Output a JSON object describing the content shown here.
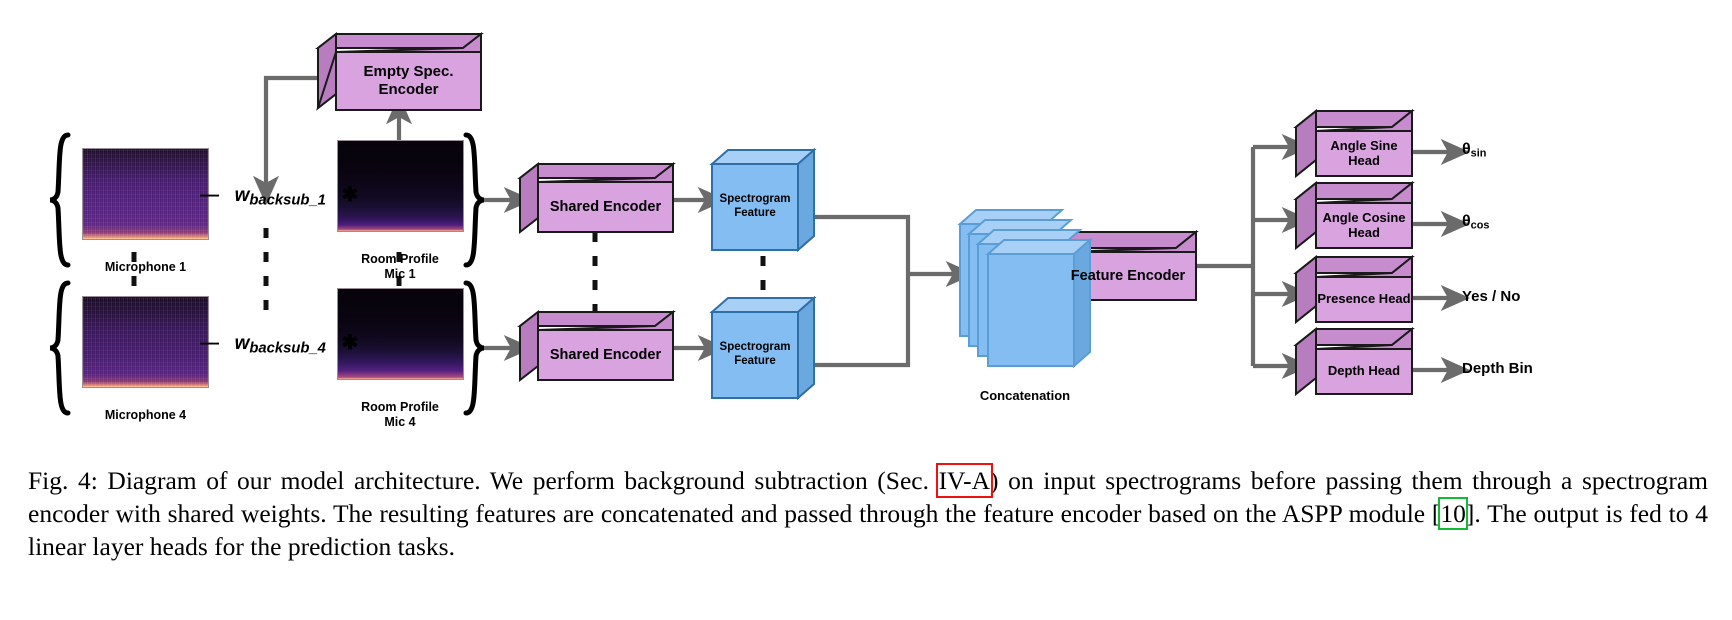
{
  "figure": {
    "title": "Diagram of our model architecture",
    "empty_spec_encoder": "Empty Spec.\nEncoder",
    "shared_encoder_1": "Shared Encoder",
    "shared_encoder_4": "Shared Encoder",
    "spectrogram_feature_1": "Spectrogram\nFeature",
    "spectrogram_feature_4": "Spectrogram\nFeature",
    "concatenation": "Concatenation",
    "feature_encoder": "Feature Encoder",
    "mic1_label": "Microphone 1",
    "mic4_label": "Microphone 4",
    "room_profile_1": "Room Profile\nMic 1",
    "room_profile_4": "Room Profile\nMic 4",
    "minus_sign": "—",
    "asterisk": "✱",
    "weight_1": {
      "base": "w",
      "sub": "backsub_1"
    },
    "weight_4": {
      "base": "w",
      "sub": "backsub_4"
    },
    "heads": [
      {
        "label": "Angle Sine\nHead",
        "output_base": "θ",
        "output_sub": "sin",
        "output_plain": ""
      },
      {
        "label": "Angle Cosine\nHead",
        "output_base": "θ",
        "output_sub": "cos",
        "output_plain": ""
      },
      {
        "label": "Presence Head",
        "output_base": "",
        "output_sub": "",
        "output_plain": "Yes / No"
      },
      {
        "label": "Depth Head",
        "output_base": "",
        "output_sub": "",
        "output_plain": "Depth Bin"
      }
    ],
    "colors": {
      "purple_front": "#d9a3e0",
      "purple_side": "#b77dbf",
      "purple_top": "#c68ccd",
      "blue_front": "#84bdf2",
      "blue_edge": "#2e6fa8",
      "arrow": "#6b6b6b",
      "outline": "#1a1a1a",
      "highlight_red": "#ee1111",
      "highlight_green": "#11bb33"
    }
  },
  "caption": {
    "figure_number": "Fig. 4:",
    "part1": " Diagram of our model architecture. We perform background subtraction (Sec. ",
    "ref_section": "IV-A",
    "part2": ") on input spectrograms before passing them through a spectrogram encoder with shared weights. The resulting features are concatenated and passed through the feature encoder based on the ASPP module [",
    "ref_citation": "10",
    "part3": "]. The output is fed to 4 linear layer heads for the prediction tasks."
  }
}
